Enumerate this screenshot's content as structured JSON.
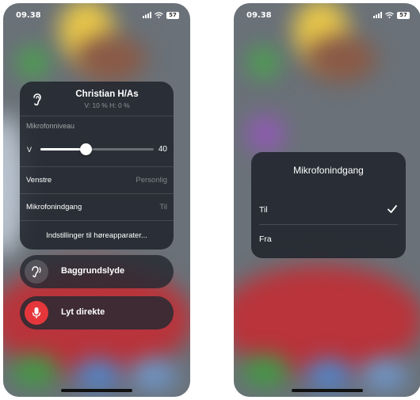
{
  "left_screen": {
    "status_bar": {
      "time": "09.38",
      "battery": "57",
      "icons": [
        "signal-icon",
        "wifi-icon",
        "battery-icon"
      ]
    },
    "device": {
      "name": "Christian H/As",
      "levels": "V: 10 %  H: 0 %",
      "icon": "ear-icon"
    },
    "mic_level": {
      "label": "Mikrofonniveau",
      "side": "V",
      "value": "40",
      "fraction": 0.4
    },
    "rows": [
      {
        "label": "Venstre",
        "value": "Personlig"
      },
      {
        "label": "Mikrofonindgang",
        "value": "Til"
      }
    ],
    "settings_link": "Indstillinger til høreapparater...",
    "buttons": [
      {
        "label": "Baggrundslyde",
        "icon": "ear-waves-icon"
      },
      {
        "label": "Lyt direkte",
        "icon": "microphone-icon",
        "color": "#e5373b"
      }
    ]
  },
  "right_screen": {
    "status_bar": {
      "time": "09.38",
      "battery": "57",
      "icons": [
        "signal-icon",
        "wifi-icon",
        "battery-icon"
      ]
    },
    "menu": {
      "title": "Mikrofonindgang",
      "options": [
        {
          "label": "Til",
          "selected": true
        },
        {
          "label": "Fra",
          "selected": false
        }
      ],
      "check_icon": "checkmark-icon"
    }
  }
}
